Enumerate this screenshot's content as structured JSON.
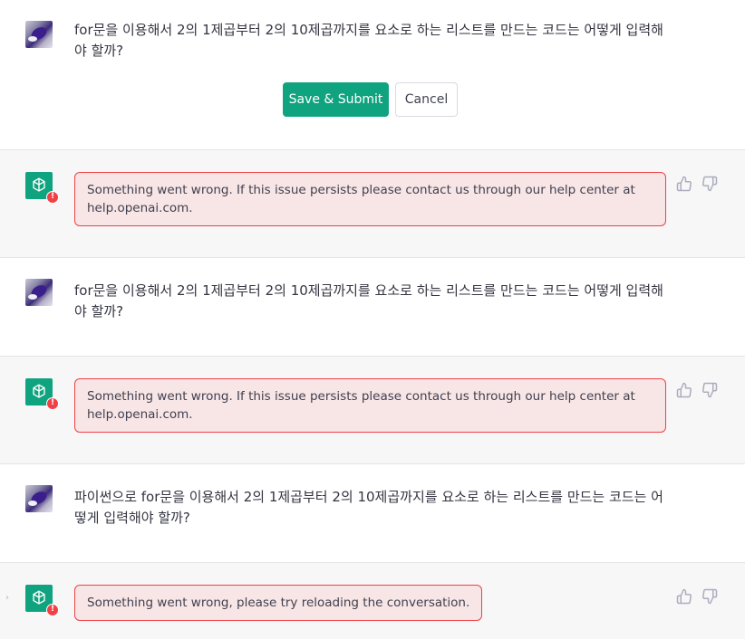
{
  "conversation": {
    "edit_message": {
      "text": "for문을 이용해서 2의 1제곱부터 2의 10제곱까지를 요소로 하는 리스트를 만드는 코드는 어떻게 입력해야 할까?",
      "save_label": "Save & Submit",
      "cancel_label": "Cancel"
    },
    "error_1": "Something went wrong. If this issue persists please contact us through our help center at help.openai.com.",
    "user_2": "for문을 이용해서 2의 1제곱부터 2의 10제곱까지를 요소로 하는 리스트를 만드는 코드는 어떻게 입력해야 할까?",
    "error_2": "Something went wrong. If this issue persists please contact us through our help center at help.openai.com.",
    "user_3": "파이썬으로 for문을 이용해서 2의 1제곱부터 2의 10제곱까지를 요소로 하는 리스트를 만드는 코드는 어떻게 입력해야 할까?",
    "error_3": "Something went wrong, please try reloading the conversation.",
    "error_badge": "!",
    "chevron": "›"
  },
  "icons": {
    "user_avatar": "user-avatar-image",
    "bot_avatar": "openai-logo-icon",
    "thumbs_up": "thumbs-up-icon",
    "thumbs_down": "thumbs-down-icon"
  },
  "colors": {
    "accent": "#10a37f",
    "error": "#ef4146",
    "error_bg": "#f8e5e6"
  }
}
